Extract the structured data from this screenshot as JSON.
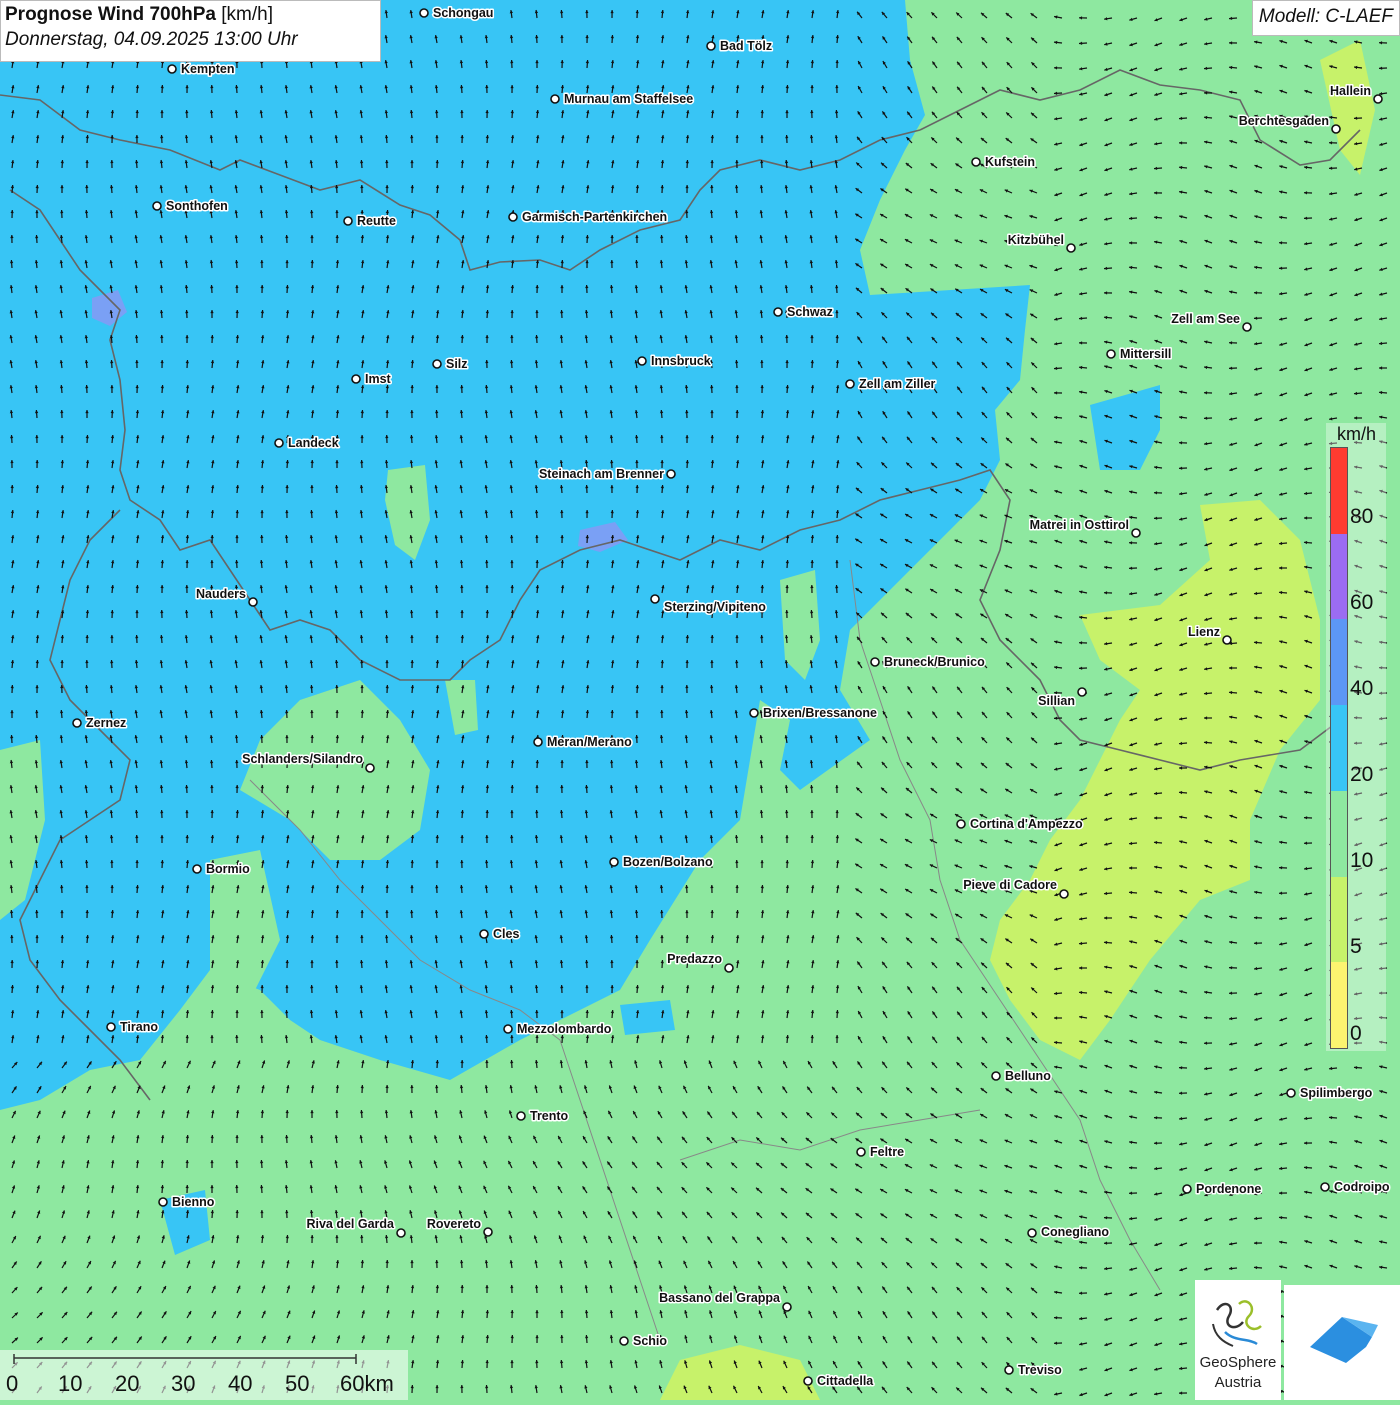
{
  "title": {
    "main": "Prognose Wind 700hPa",
    "unit": "[km/h]",
    "datetime": "Donnerstag, 04.09.2025 13:00 Uhr"
  },
  "model": "Modell: C-LAEF",
  "legend": {
    "unit": "km/h",
    "ticks": [
      "80",
      "60",
      "40",
      "20",
      "10",
      "5",
      "0"
    ],
    "colors": [
      "#ff3b30",
      "#9b6cf2",
      "#5c97f5",
      "#38c5f5",
      "#8ee8a0",
      "#c7f26a",
      "#fcf470"
    ]
  },
  "scalebar": {
    "labels": [
      "0",
      "10",
      "20",
      "30",
      "40",
      "50",
      "60km"
    ]
  },
  "logo": {
    "geosphere_line1": "GeoSphere",
    "geosphere_line2": "Austria"
  },
  "cities": [
    {
      "name": "Schongau"
    },
    {
      "name": "Bad Tölz"
    },
    {
      "name": "Kempten"
    },
    {
      "name": "Murnau am Staffelsee"
    },
    {
      "name": "Hallein"
    },
    {
      "name": "Berchtesgaden"
    },
    {
      "name": "Kufstein"
    },
    {
      "name": "Sonthofen"
    },
    {
      "name": "Reutte"
    },
    {
      "name": "Garmisch-Partenkirchen"
    },
    {
      "name": "Kitzbühel"
    },
    {
      "name": "Schwaz"
    },
    {
      "name": "Zell am See"
    },
    {
      "name": "Mittersill"
    },
    {
      "name": "Innsbruck"
    },
    {
      "name": "Silz"
    },
    {
      "name": "Imst"
    },
    {
      "name": "Zell am Ziller"
    },
    {
      "name": "Landeck"
    },
    {
      "name": "Steinach am Brenner"
    },
    {
      "name": "Matrei in Osttirol"
    },
    {
      "name": "Nauders"
    },
    {
      "name": "Sterzing/Vipiteno"
    },
    {
      "name": "Lienz"
    },
    {
      "name": "Bruneck/Brunico"
    },
    {
      "name": "Sillian"
    },
    {
      "name": "Zernez"
    },
    {
      "name": "Brixen/Bressanone"
    },
    {
      "name": "Meran/Merano"
    },
    {
      "name": "Schlanders/Silandro"
    },
    {
      "name": "Cortina d'Ampezzo"
    },
    {
      "name": "Bozen/Bolzano"
    },
    {
      "name": "Bormio"
    },
    {
      "name": "Pieve di Cadore"
    },
    {
      "name": "Cles"
    },
    {
      "name": "Predazzo"
    },
    {
      "name": "Tirano"
    },
    {
      "name": "Mezzolombardo"
    },
    {
      "name": "Belluno"
    },
    {
      "name": "Spilimbergo"
    },
    {
      "name": "Trento"
    },
    {
      "name": "Feltre"
    },
    {
      "name": "Pordenone"
    },
    {
      "name": "Codroipo"
    },
    {
      "name": "Bienno"
    },
    {
      "name": "Riva del Garda"
    },
    {
      "name": "Rovereto"
    },
    {
      "name": "Conegliano"
    },
    {
      "name": "Bassano del Grappa"
    },
    {
      "name": "Schio"
    },
    {
      "name": "Treviso"
    },
    {
      "name": "Cittadella"
    }
  ]
}
